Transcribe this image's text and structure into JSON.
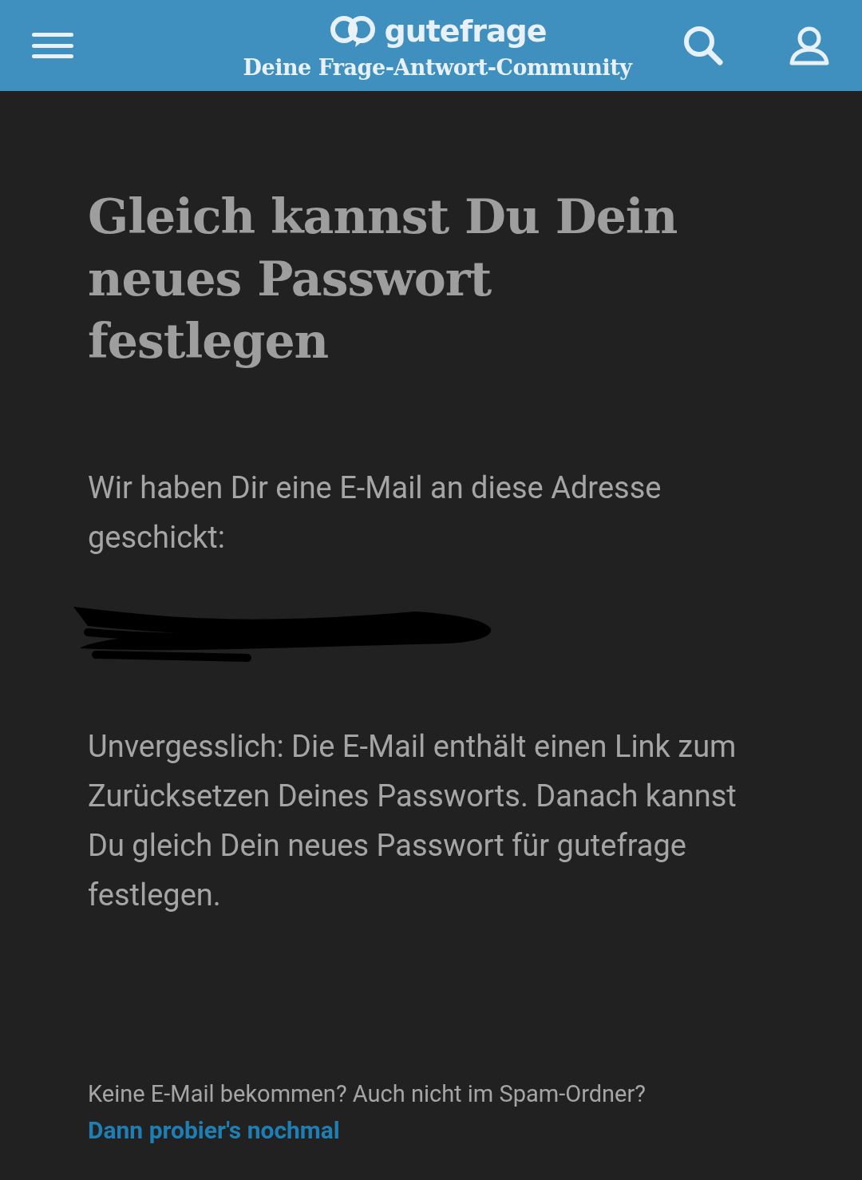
{
  "header": {
    "logo": "gutefrage",
    "tagline": "Deine Frage-Antwort-Community"
  },
  "heading": "Gleich kannst Du Dein neues Passwort festlegen",
  "intro": "Wir haben Dir eine E-Mail an diese Adresse geschickt:",
  "info": "Unvergesslich: Die E-Mail enthält einen Link zum Zurücksetzen Deines Passworts. Danach kannst Du gleich Dein neues Passwort für gutefrage festlegen.",
  "footer": {
    "question": "Keine E-Mail bekommen? Auch nicht im Spam-Ordner?",
    "link": "Dann probier's nochmal"
  }
}
